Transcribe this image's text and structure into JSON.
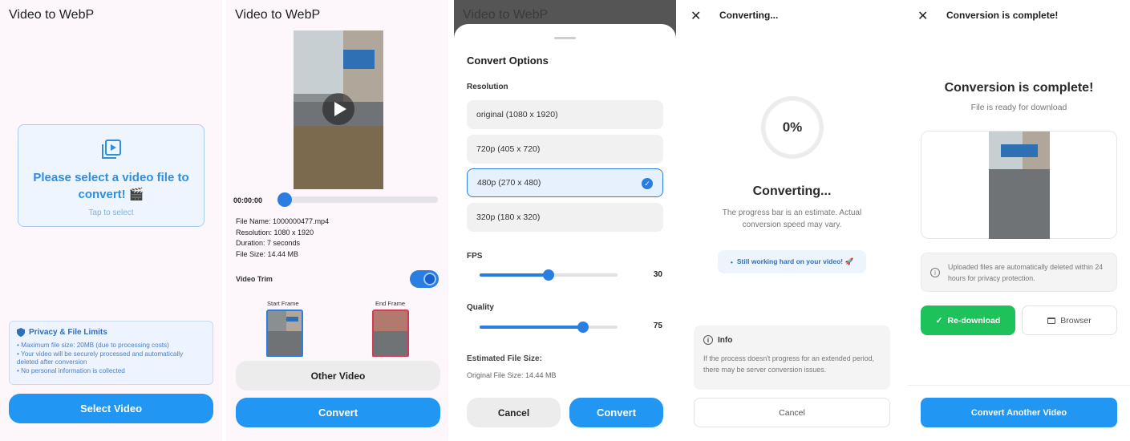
{
  "screen1": {
    "title": "Video to WebP",
    "dropzone_title": "Please select a video file to convert! 🎬",
    "dropzone_sub": "Tap to select",
    "privacy_title": "Privacy & File Limits",
    "privacy_items": [
      "• Maximum file size: 20MB (due to processing costs)",
      "• Your video will be securely processed and automatically deleted after conversion",
      "• No personal information is collected"
    ],
    "select_button": "Select Video"
  },
  "screen2": {
    "title": "Video to WebP",
    "time": "00:00:00",
    "file_name": "File Name: 1000000477.mp4",
    "resolution": "Resolution: 1080 x 1920",
    "duration": "Duration: 7 seconds",
    "file_size": "File Size: 14.44 MB",
    "trim_label": "Video Trim",
    "start_frame": "Start Frame",
    "end_frame": "End Frame",
    "other_button": "Other Video",
    "convert_button": "Convert"
  },
  "screen3": {
    "title": "Video to WebP",
    "sheet_title": "Convert Options",
    "resolution_label": "Resolution",
    "options": [
      "original (1080 x 1920)",
      "720p (405 x 720)",
      "480p (270 x 480)",
      "320p (180 x 320)"
    ],
    "selected_option": "480p (270 x 480)",
    "fps_label": "FPS",
    "fps_value": "30",
    "fps_fraction": 0.5,
    "quality_label": "Quality",
    "quality_value": "75",
    "quality_fraction": 0.75,
    "estimated_label": "Estimated File Size:",
    "original_size": "Original File Size: 14.44 MB",
    "cancel_button": "Cancel",
    "convert_button": "Convert"
  },
  "screen4": {
    "close_icon": "✕",
    "title": "Converting...",
    "progress": "0%",
    "heading": "Converting...",
    "subtitle": "The progress bar is an estimate. Actual conversion speed may vary.",
    "status_pill": "Still working hard on your video! 🚀",
    "info_title": "Info",
    "info_body": "If the process doesn't progress for an extended period, there may be server conversion issues.",
    "cancel_button": "Cancel"
  },
  "screen5": {
    "close_icon": "✕",
    "title": "Conversion is complete!",
    "heading": "Conversion is complete!",
    "subtitle": "File is ready for download",
    "note": "Uploaded files are automatically deleted within 24 hours for privacy protection.",
    "redownload_button": "Re-download",
    "browser_button": "Browser",
    "another_button": "Convert Another Video"
  },
  "colors": {
    "accent": "#2196f3",
    "success": "#1dc25a",
    "end_frame": "#d53b53"
  }
}
